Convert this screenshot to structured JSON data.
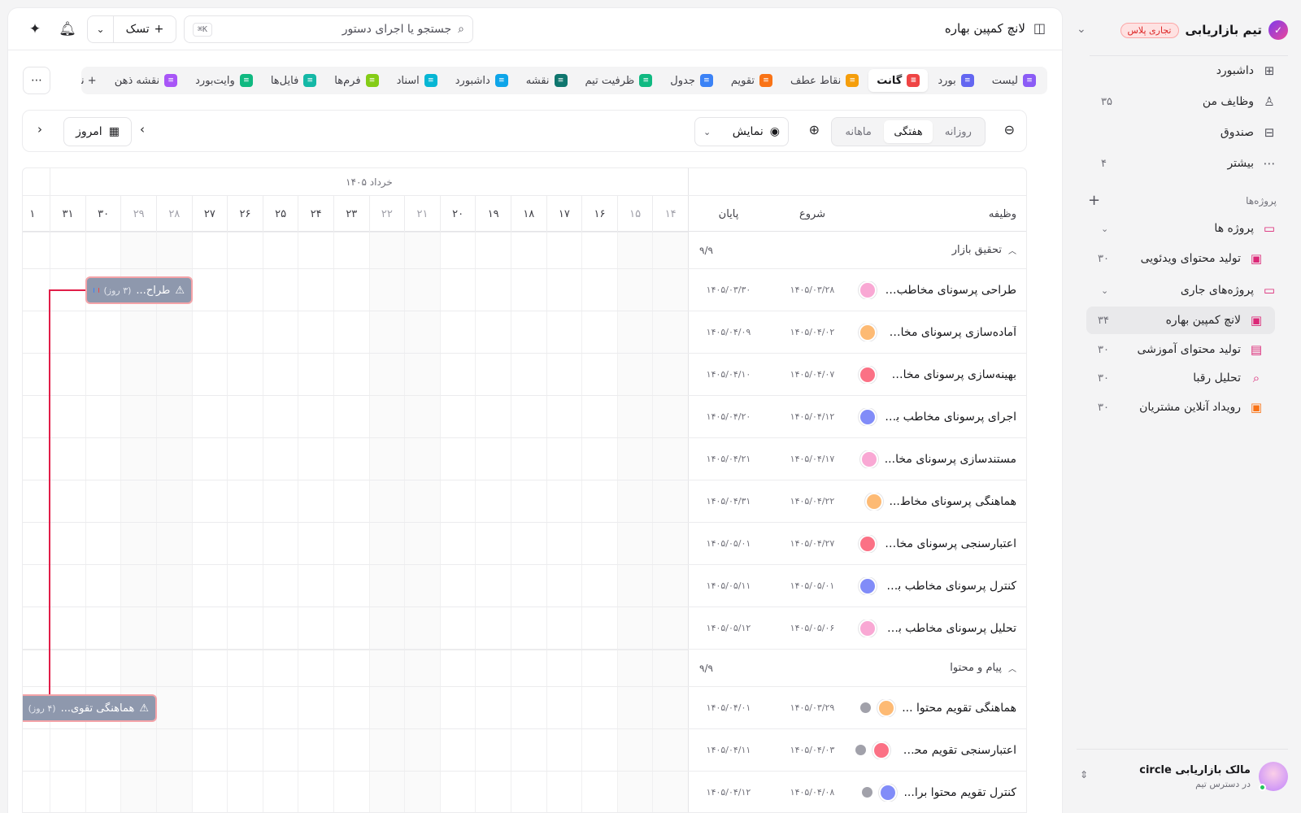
{
  "workspace": {
    "name": "تیم بازاریابی",
    "badge": "تجاری پلاس"
  },
  "nav": [
    {
      "label": "داشبورد",
      "icon": "grid-icon",
      "count": ""
    },
    {
      "label": "وظایف من",
      "icon": "user-icon",
      "count": "۳۵"
    },
    {
      "label": "صندوق",
      "icon": "inbox-icon",
      "count": ""
    },
    {
      "label": "بیشتر",
      "icon": "more-icon",
      "count": "۴"
    }
  ],
  "projects_section": {
    "title": "پروژه‌ها"
  },
  "tree": [
    {
      "label": "پروژه ها",
      "type": "folder",
      "count": ""
    },
    {
      "label": "تولید محتوای ویدئویی",
      "type": "project",
      "count": "۳۰"
    },
    {
      "label": "پروژه‌های جاری",
      "type": "folder",
      "count": ""
    },
    {
      "label": "لانچ کمپین بهاره",
      "type": "project",
      "count": "۳۴"
    },
    {
      "label": "تولید محتوای آموزشی",
      "type": "book",
      "count": "۳۰"
    },
    {
      "label": "تحلیل رقبا",
      "type": "search",
      "count": "۳۰"
    },
    {
      "label": "رویداد آنلاین مشتریان",
      "type": "project-orange",
      "count": "۳۰"
    }
  ],
  "user": {
    "name": "مالک بازاریابی circle",
    "subtitle": "در دسترس تیم"
  },
  "header": {
    "title": "لانچ کمپین بهاره",
    "search_placeholder": "جستجو یا اجرای دستور",
    "search_shortcut": "⌘K",
    "new_task_label": "تسک"
  },
  "view_tabs": [
    {
      "label": "لیست",
      "color": "#8b5cf6",
      "active": false
    },
    {
      "label": "بورد",
      "color": "#6366f1",
      "active": false
    },
    {
      "label": "گانت",
      "color": "#ef4444",
      "active": true
    },
    {
      "label": "نقاط عطف",
      "color": "#f59e0b",
      "active": false
    },
    {
      "label": "تقویم",
      "color": "#f97316",
      "active": false
    },
    {
      "label": "جدول",
      "color": "#3b82f6",
      "active": false
    },
    {
      "label": "ظرفیت تیم",
      "color": "#10b981",
      "active": false
    },
    {
      "label": "نقشه",
      "color": "#0f766e",
      "active": false
    },
    {
      "label": "داشبورد",
      "color": "#0ea5e9",
      "active": false
    },
    {
      "label": "اسناد",
      "color": "#06b6d4",
      "active": false
    },
    {
      "label": "فرم‌ها",
      "color": "#84cc16",
      "active": false
    },
    {
      "label": "فایل‌ها",
      "color": "#14b8a6",
      "active": false
    },
    {
      "label": "وایت‌بورد",
      "color": "#10b981",
      "active": false
    },
    {
      "label": "نقشه ذهن",
      "color": "#a855f7",
      "active": false
    },
    {
      "label": "+ نما",
      "color": "",
      "active": false
    }
  ],
  "toolbar": {
    "scales": [
      "روزانه",
      "هفتگی",
      "ماهانه"
    ],
    "active_scale": "هفتگی",
    "display_label": "نمایش",
    "today_label": "امروز"
  },
  "gantt": {
    "month_label": "۱۴۰۵ خرداد",
    "days": [
      "۱۴",
      "۱۵",
      "۱۶",
      "۱۷",
      "۱۸",
      "۱۹",
      "۲۰",
      "۲۱",
      "۲۲",
      "۲۳",
      "۲۴",
      "۲۵",
      "۲۶",
      "۲۷",
      "۲۸",
      "۲۹",
      "۳۰",
      "۳۱",
      "۱"
    ],
    "weekend_days": [
      "۱۴",
      "۱۵",
      "۲۱",
      "۲۲",
      "۲۸",
      "۲۹"
    ],
    "columns": {
      "task": "وظیفه",
      "start": "شروع",
      "end": "پایان"
    },
    "groups": [
      {
        "name": "تحقیق بازار",
        "count": "۹/۹",
        "tasks": [
          {
            "name": "طراحی پرسونای مخاطب بر...",
            "start": "۱۴۰۵/۰۳/۲۸",
            "end": "۱۴۰۵/۰۳/۳۰",
            "avatar": "#f9a8d4"
          },
          {
            "name": "آماده‌سازی پرسونای مخاط...",
            "start": "۱۴۰۵/۰۴/۰۲",
            "end": "۱۴۰۵/۰۴/۰۹",
            "avatar": "#fdba74"
          },
          {
            "name": "بهینه‌سازی پرسونای مخاط...",
            "start": "۱۴۰۵/۰۴/۰۷",
            "end": "۱۴۰۵/۰۴/۱۰",
            "avatar": "#fb7185"
          },
          {
            "name": "اجرای پرسونای مخاطب برا...",
            "start": "۱۴۰۵/۰۴/۱۲",
            "end": "۱۴۰۵/۰۴/۲۰",
            "avatar": "#818cf8"
          },
          {
            "name": "مستندسازی پرسونای مخا...",
            "start": "۱۴۰۵/۰۴/۱۷",
            "end": "۱۴۰۵/۰۴/۲۱",
            "avatar": "#f9a8d4"
          },
          {
            "name": "هماهنگی پرسونای مخاط...",
            "start": "۱۴۰۵/۰۴/۲۲",
            "end": "۱۴۰۵/۰۴/۳۱",
            "avatar": "#fdba74"
          },
          {
            "name": "اعتبارسنجی پرسونای مخاط...",
            "start": "۱۴۰۵/۰۴/۲۷",
            "end": "۱۴۰۵/۰۵/۰۱",
            "avatar": "#fb7185"
          },
          {
            "name": "کنترل پرسونای مخاطب برا...",
            "start": "۱۴۰۵/۰۵/۰۱",
            "end": "۱۴۰۵/۰۵/۱۱",
            "avatar": "#818cf8"
          },
          {
            "name": "تحلیل پرسونای مخاطب برا...",
            "start": "۱۴۰۵/۰۵/۰۶",
            "end": "۱۴۰۵/۰۵/۱۲",
            "avatar": "#f9a8d4"
          }
        ]
      },
      {
        "name": "پیام و محتوا",
        "count": "۹/۹",
        "tasks": [
          {
            "name": "هماهنگی تقویم محتوا ...",
            "start": "۱۴۰۵/۰۳/۲۹",
            "end": "۱۴۰۵/۰۴/۰۱",
            "avatar": "#fdba74"
          },
          {
            "name": "اعتبارسنجی تقویم محت...",
            "start": "۱۴۰۵/۰۴/۰۳",
            "end": "۱۴۰۵/۰۴/۱۱",
            "avatar": "#fb7185"
          },
          {
            "name": "کنترل تقویم محتوا برا...",
            "start": "۱۴۰۵/۰۴/۰۸",
            "end": "۱۴۰۵/۰۴/۱۲",
            "avatar": "#818cf8"
          }
        ]
      }
    ],
    "bars": [
      {
        "label": "طراح...",
        "duration": "(۳ روز)",
        "dots": [
          "#ef4444",
          "#3b82f6"
        ]
      },
      {
        "label": "هماهنگی تقوی...",
        "duration": "(۴ روز)",
        "dots": [
          "#f97316",
          "#a855f7"
        ]
      }
    ]
  }
}
